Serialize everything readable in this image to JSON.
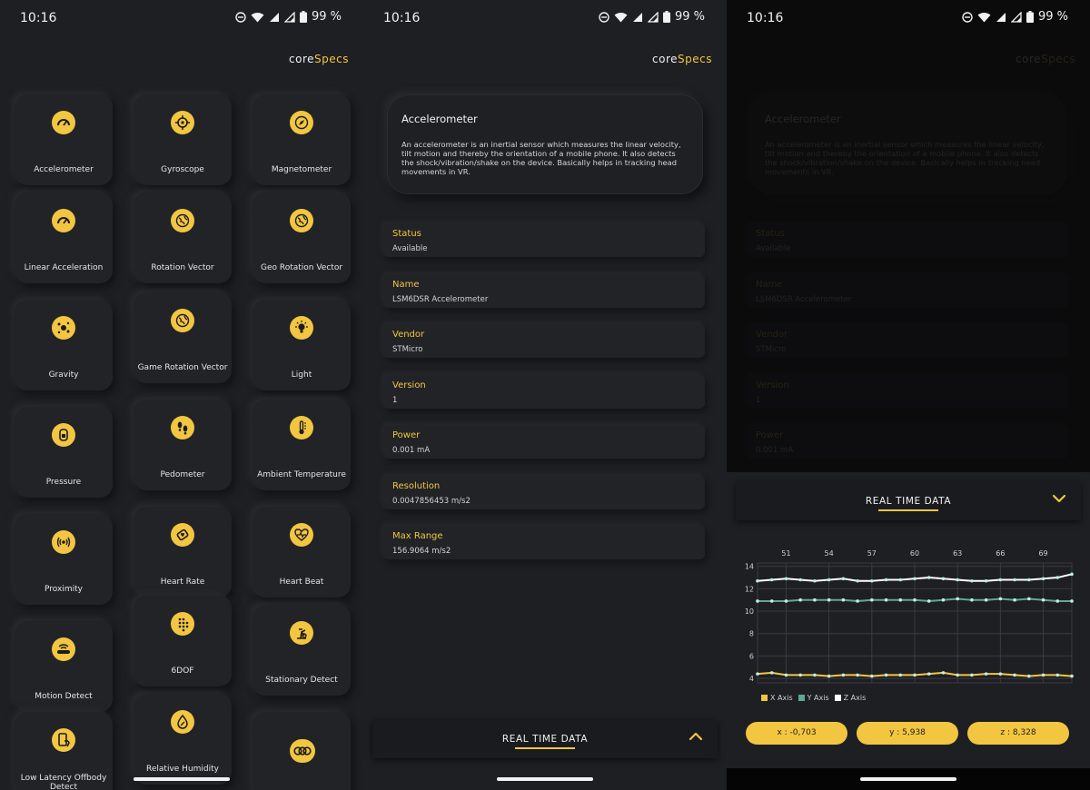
{
  "status": {
    "time": "10:16",
    "battery": "99 %"
  },
  "brand": {
    "core": "core",
    "specs": "Specs"
  },
  "colors": {
    "accent": "#f2c641",
    "background": "#1e1f23",
    "x_axis": "#f2c641",
    "y_axis": "#5fa894",
    "z_axis": "#ffffff"
  },
  "sensors": [
    {
      "label": "Accelerometer",
      "icon": "gauge-icon"
    },
    {
      "label": "Gyroscope",
      "icon": "crosshair-icon"
    },
    {
      "label": "Magnetometer",
      "icon": "compass-icon"
    },
    {
      "label": "Linear Acceleration",
      "icon": "gauge-icon"
    },
    {
      "label": "Rotation Vector",
      "icon": "globe-icon"
    },
    {
      "label": "Geo Rotation Vector",
      "icon": "globe-icon"
    },
    {
      "label": "Gravity",
      "icon": "gravity-icon"
    },
    {
      "label": "Game Rotation Vector",
      "icon": "globe-icon"
    },
    {
      "label": "Light",
      "icon": "bulb-icon"
    },
    {
      "label": "Pressure",
      "icon": "pressure-icon"
    },
    {
      "label": "Pedometer",
      "icon": "footprints-icon"
    },
    {
      "label": "Ambient Temperature",
      "icon": "thermometer-icon"
    },
    {
      "label": "Proximity",
      "icon": "proximity-icon"
    },
    {
      "label": "Heart Rate",
      "icon": "heart-rate-icon"
    },
    {
      "label": "Heart Beat",
      "icon": "heartbeat-icon"
    },
    {
      "label": "Motion Detect",
      "icon": "motion-icon"
    },
    {
      "label": "6DOF",
      "icon": "dots-icon"
    },
    {
      "label": "Stationary Detect",
      "icon": "bike-icon"
    },
    {
      "label": "Low Latency Offbody Detect",
      "icon": "phone-hand-icon"
    },
    {
      "label": "Relative Humidity",
      "icon": "drop-icon"
    },
    {
      "label": "",
      "icon": "rings-icon"
    }
  ],
  "detail": {
    "title": "Accelerometer",
    "description": "An accelerometer is an inertial sensor which measures the linear velocity, tilt motion and thereby the orientation of a mobile phone. It also detects the shock/vibration/shake on the device. Basically helps in tracking head movements in VR.",
    "properties": [
      {
        "key": "Status",
        "value": "Available"
      },
      {
        "key": "Name",
        "value": "LSM6DSR Accelerometer"
      },
      {
        "key": "Vendor",
        "value": "STMicro"
      },
      {
        "key": "Version",
        "value": "1"
      },
      {
        "key": "Power",
        "value": "0.001 mA"
      },
      {
        "key": "Resolution",
        "value": "0.0047856453 m/s2"
      },
      {
        "key": "Max Range",
        "value": "156.9064 m/s2"
      }
    ]
  },
  "realtime": {
    "label": "REAL TIME DATA"
  },
  "readouts": {
    "x": "x : -0,703",
    "y": "y : 5,938",
    "z": "z : 8,328"
  },
  "chart_data": {
    "type": "line",
    "x": [
      49,
      50,
      51,
      52,
      53,
      54,
      55,
      56,
      57,
      58,
      59,
      60,
      61,
      62,
      63,
      64,
      65,
      66,
      67,
      68,
      69,
      70,
      71
    ],
    "x_ticks": [
      "51",
      "54",
      "57",
      "60",
      "63",
      "66",
      "69"
    ],
    "y_ticks": [
      "4",
      "6",
      "8",
      "10",
      "12",
      "14"
    ],
    "ylim": [
      3.6,
      14.3
    ],
    "series": [
      {
        "name": "X Axis",
        "color": "#f2c641",
        "values": [
          4.4,
          4.5,
          4.3,
          4.3,
          4.3,
          4.2,
          4.3,
          4.3,
          4.2,
          4.3,
          4.3,
          4.3,
          4.4,
          4.5,
          4.3,
          4.3,
          4.4,
          4.4,
          4.3,
          4.2,
          4.3,
          4.3,
          4.2
        ]
      },
      {
        "name": "Y Axis",
        "color": "#5fa894",
        "values": [
          10.9,
          10.9,
          10.9,
          11.0,
          11.0,
          11.0,
          11.0,
          10.9,
          11.0,
          11.0,
          11.0,
          11.0,
          10.9,
          11.0,
          11.1,
          11.0,
          11.0,
          11.1,
          11.0,
          11.1,
          11.0,
          10.9,
          10.9
        ]
      },
      {
        "name": "Z Axis",
        "color": "#ffffff",
        "values": [
          12.7,
          12.8,
          12.9,
          12.8,
          12.7,
          12.8,
          12.9,
          12.7,
          12.7,
          12.8,
          12.8,
          12.9,
          13.0,
          12.9,
          12.8,
          12.7,
          12.7,
          12.8,
          12.8,
          12.8,
          12.9,
          13.0,
          13.3
        ]
      }
    ]
  }
}
